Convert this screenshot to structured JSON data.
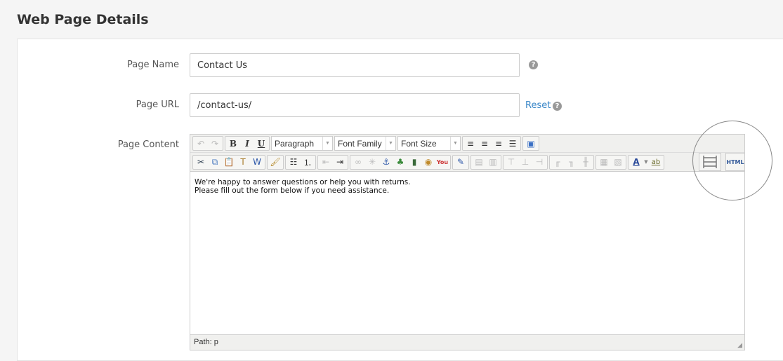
{
  "page_title": "Web Page Details",
  "form": {
    "page_name": {
      "label": "Page Name",
      "value": "Contact Us"
    },
    "page_url": {
      "label": "Page URL",
      "value": "/contact-us/",
      "reset_label": "Reset"
    },
    "page_content": {
      "label": "Page Content"
    }
  },
  "editor": {
    "format_select": "Paragraph",
    "font_family_select": "Font Family",
    "font_size_select": "Font Size",
    "content_lines": [
      "We're happy to answer questions or help you with returns.",
      "Please fill out the form below if you need assistance."
    ],
    "status": "Path: p",
    "html_button": "HTML",
    "highlight_color": "#888888"
  }
}
